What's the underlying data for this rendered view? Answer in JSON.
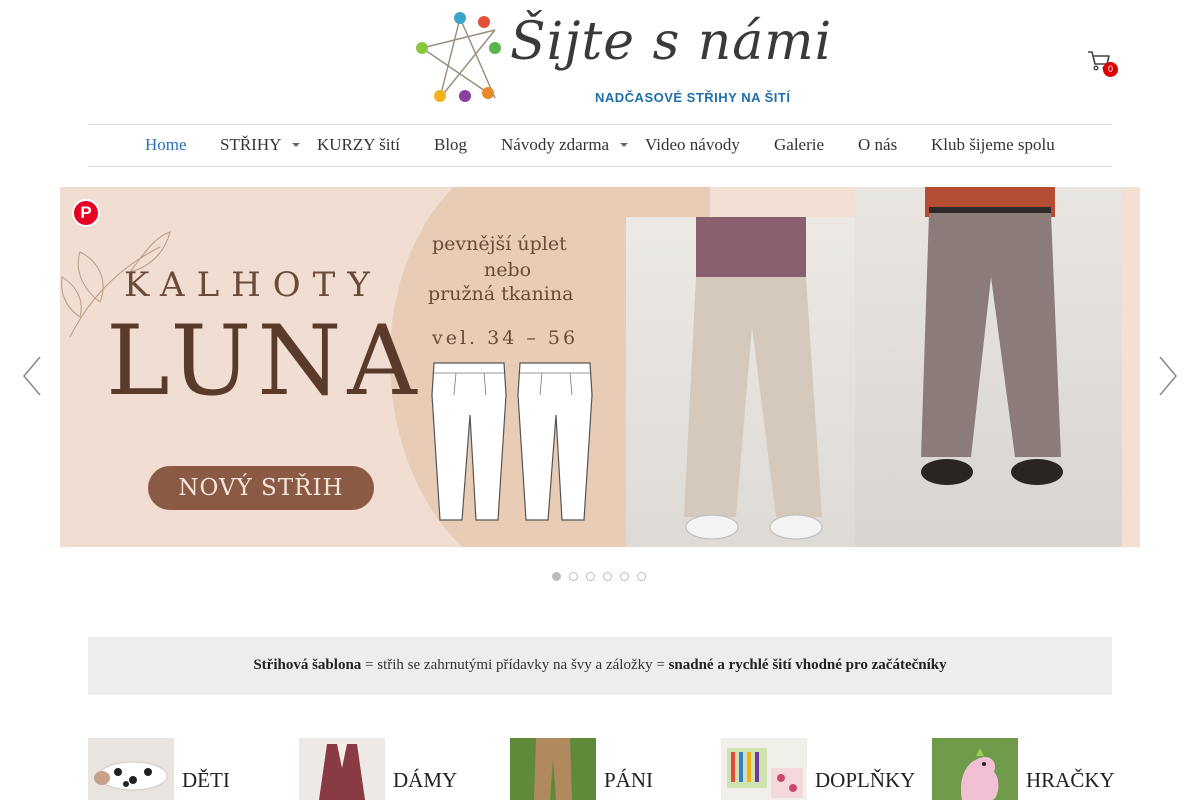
{
  "header": {
    "logo_title": "Šijte s námi",
    "logo_subtitle": "NADČASOVÉ STŘIHY NA ŠITÍ",
    "logo_icon": "pins-logo-icon",
    "cart_icon": "cart-icon",
    "cart_count": "0"
  },
  "nav": {
    "items": [
      {
        "label": "Home",
        "active": true
      },
      {
        "label": "STŘIHY",
        "has_dropdown": true
      },
      {
        "label": "KURZY šití"
      },
      {
        "label": "Blog"
      },
      {
        "label": "Návody zdarma",
        "has_dropdown": true
      },
      {
        "label": "Video návody"
      },
      {
        "label": "Galerie"
      },
      {
        "label": "O nás"
      },
      {
        "label": "Klub šijeme spolu"
      }
    ]
  },
  "slider": {
    "pin_icon": "pinterest-icon",
    "title_small": "KALHOTY",
    "title_big": "LUNA",
    "line1": "pevnější úplet",
    "line2": "nebo",
    "line3": "pružná tkanina",
    "sizes": "vel. 34 – 56",
    "badge": "NOVÝ STŘIH",
    "slide_count": 6,
    "active_slide": 1
  },
  "info_bar": {
    "part1": "Střihová šablona",
    "part2": " = střih se zahrnutými přídavky na švy a záložky = ",
    "part3": "snadné a rychlé šití vhodné pro začátečníky"
  },
  "categories": [
    {
      "label": "DĚTI"
    },
    {
      "label": "DÁMY"
    },
    {
      "label": "PÁNI"
    },
    {
      "label": "DOPLŇKY"
    },
    {
      "label": "HRAČKY"
    }
  ],
  "colors": {
    "accent": "#2a6fb5",
    "logo_blue": "#1e6fa8",
    "badge_red": "#e00000",
    "info_bg": "#ededed"
  }
}
